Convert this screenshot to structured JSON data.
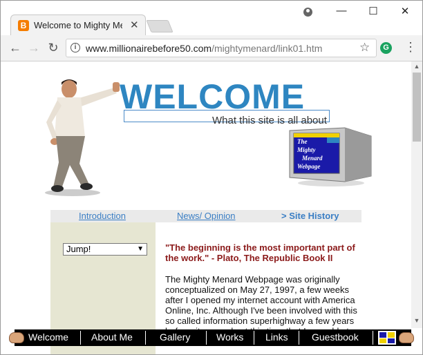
{
  "browser": {
    "tab_title": "Welcome to Mighty Menard",
    "url_host": "www.millionairebefore50.com",
    "url_path": "/mightymenard/link01.htm",
    "favicon": "B",
    "ext_letter": "G"
  },
  "header": {
    "welcome": "WELCOME",
    "subtitle": "What this site is all about",
    "monitor_line1": "The",
    "monitor_line2": "Mighty",
    "monitor_line3": "Menard",
    "monitor_line4": "Webpage"
  },
  "menu": {
    "introduction": "Introduction",
    "news": "News/ Opinion",
    "current_prefix": ">",
    "current": "Site History"
  },
  "sidebar": {
    "jump_selected": "Jump!"
  },
  "content": {
    "quote": "\"The beginning is the most important part of the work.\"   - Plato, The Republic Book II",
    "paragraph": "The Mighty Menard Webpage was originally conceptualized on May 27, 1997, a few weeks after I opened my internet account with America Online, Inc. Although I've been involved with this so called information superhighway a few years before, it was only at this time that I was able to"
  },
  "bottom_nav": {
    "items": [
      "Welcome",
      "About Me",
      "Gallery",
      "Works",
      "Links",
      "Guestbook"
    ]
  },
  "colors": {
    "accent": "#2e86c1",
    "quote": "#8b1a1a",
    "sidebar": "#e6e6d2"
  }
}
